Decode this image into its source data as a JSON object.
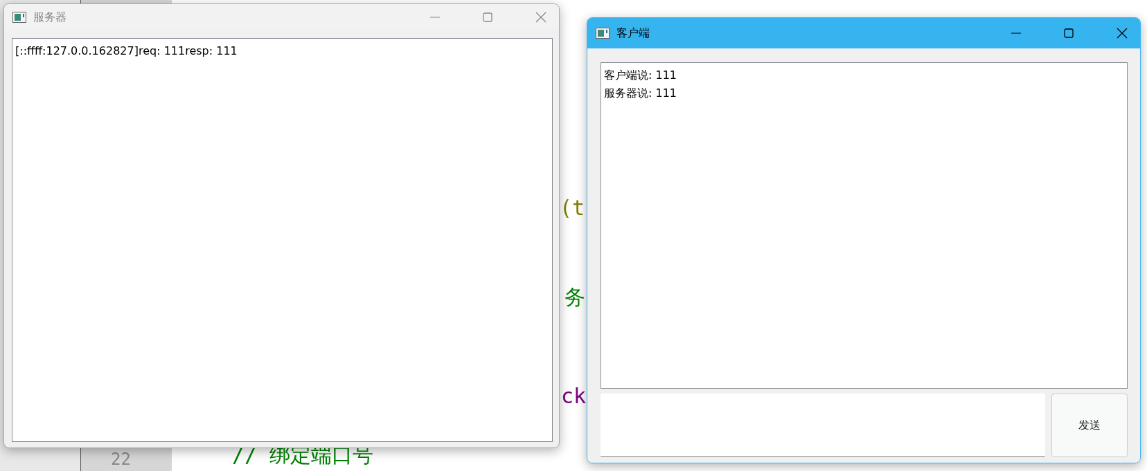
{
  "editor": {
    "fragments": [
      {
        "text": "(t",
        "kind": "param"
      },
      {
        "text": "务",
        "kind": "comment"
      },
      {
        "text": "ck",
        "kind": "member"
      },
      {
        "text": "// 绑定端口号",
        "kind": "comment"
      }
    ],
    "line_numbers": [
      "22"
    ]
  },
  "windows": [
    {
      "title": "服务器",
      "active": false,
      "log": [
        "[::ffff:127.0.0.162827]req: 111resp: 111"
      ]
    },
    {
      "title": "客户端",
      "active": true,
      "log": [
        "客户端说: 111",
        "服务器说: 111"
      ],
      "send_button": "发送"
    }
  ]
}
